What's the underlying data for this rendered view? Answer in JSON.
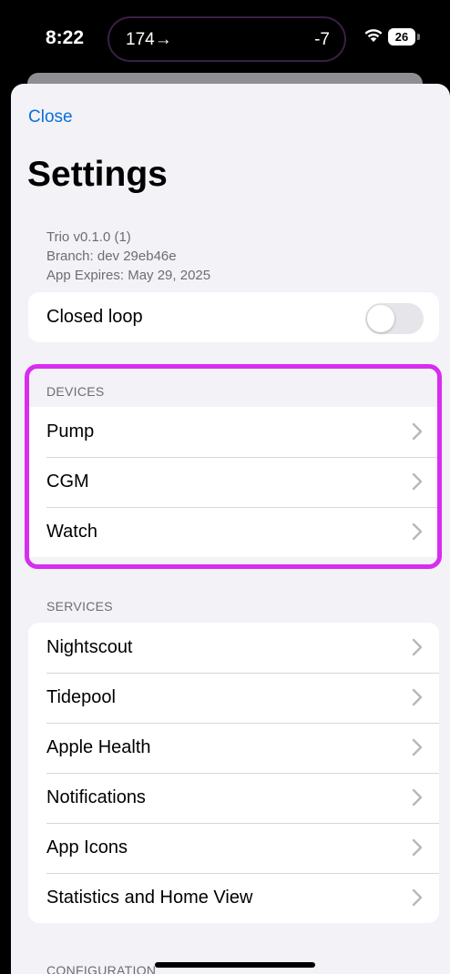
{
  "status_bar": {
    "time": "8:22",
    "island_left": "174→",
    "island_right": "-7",
    "battery": "26"
  },
  "sheet": {
    "close_label": "Close",
    "title": "Settings",
    "version_lines": [
      "Trio v0.1.0 (1)",
      "Branch: dev 29eb46e",
      "App Expires: May 29, 2025"
    ]
  },
  "closed_loop": {
    "label": "Closed loop",
    "enabled": false
  },
  "sections": {
    "devices": {
      "header": "DEVICES",
      "items": [
        {
          "label": "Pump"
        },
        {
          "label": "CGM"
        },
        {
          "label": "Watch"
        }
      ]
    },
    "services": {
      "header": "SERVICES",
      "items": [
        {
          "label": "Nightscout"
        },
        {
          "label": "Tidepool"
        },
        {
          "label": "Apple Health"
        },
        {
          "label": "Notifications"
        },
        {
          "label": "App Icons"
        },
        {
          "label": "Statistics and Home View"
        }
      ]
    },
    "configuration": {
      "header": "CONFIGURATION"
    }
  },
  "colors": {
    "accent": "#0a6fd8",
    "highlight": "#d82cf0",
    "background": "#f2f2f7"
  }
}
